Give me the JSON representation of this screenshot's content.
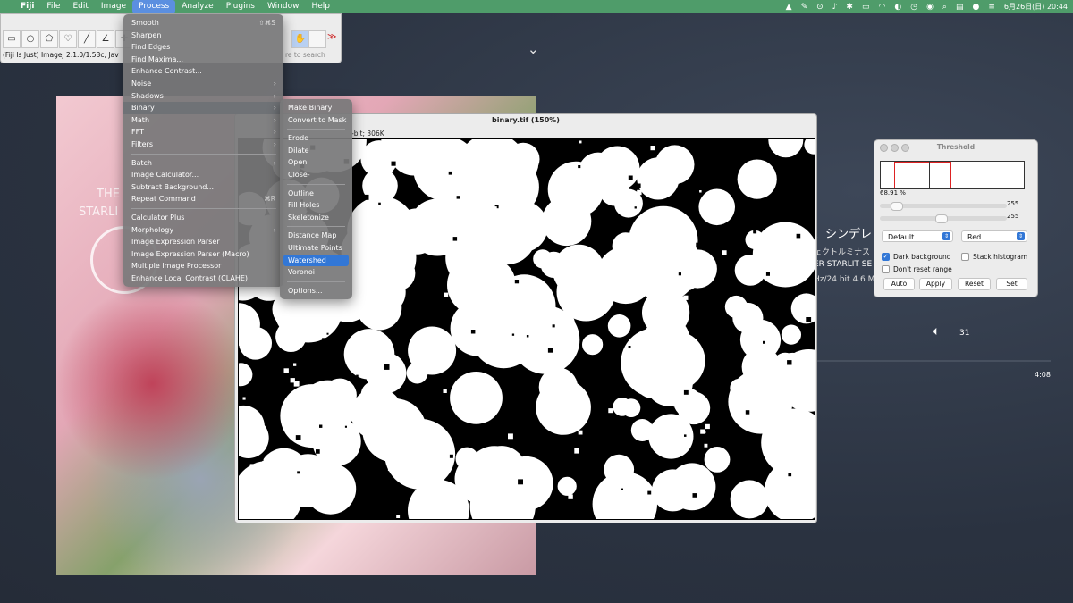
{
  "menubar": {
    "app_name": "Fiji",
    "menus": [
      "File",
      "Edit",
      "Image",
      "Process",
      "Analyze",
      "Plugins",
      "Window",
      "Help"
    ],
    "active_menu": "Process",
    "clock": "6月26日(日)  20:44"
  },
  "toolbar": {
    "status": "(Fiji Is Just) ImageJ 2.1.0/1.53c; Jav",
    "search_placeholder": "re to search"
  },
  "process_menu": {
    "items": [
      {
        "label": "Smooth",
        "shortcut": "⇧⌘S"
      },
      {
        "label": "Sharpen"
      },
      {
        "label": "Find Edges"
      },
      {
        "label": "Find Maxima..."
      },
      {
        "label": "Enhance Contrast..."
      },
      {
        "label": "Noise",
        "submenu": true
      },
      {
        "label": "Shadows",
        "submenu": true
      },
      {
        "label": "Binary",
        "submenu": true,
        "highlighted": true
      },
      {
        "label": "Math",
        "submenu": true
      },
      {
        "label": "FFT",
        "submenu": true
      },
      {
        "label": "Filters",
        "submenu": true
      },
      {
        "separator": true
      },
      {
        "label": "Batch",
        "submenu": true
      },
      {
        "label": "Image Calculator..."
      },
      {
        "label": "Subtract Background..."
      },
      {
        "label": "Repeat Command",
        "shortcut": "⌘R"
      },
      {
        "separator": true
      },
      {
        "label": "Calculator Plus"
      },
      {
        "label": "Morphology",
        "submenu": true
      },
      {
        "label": "Image Expression Parser"
      },
      {
        "label": "Image Expression Parser (Macro)"
      },
      {
        "label": "Multiple Image Processor"
      },
      {
        "label": "Enhance Local Contrast (CLAHE)"
      }
    ]
  },
  "binary_menu": {
    "items": [
      {
        "label": "Make Binary"
      },
      {
        "label": "Convert to Mask"
      },
      {
        "separator": true
      },
      {
        "label": "Erode"
      },
      {
        "label": "Dilate"
      },
      {
        "label": "Open"
      },
      {
        "label": "Close-"
      },
      {
        "separator": true
      },
      {
        "label": "Outline"
      },
      {
        "label": "Fill Holes"
      },
      {
        "label": "Skeletonize"
      },
      {
        "separator": true
      },
      {
        "label": "Distance Map"
      },
      {
        "label": "Ultimate Points"
      },
      {
        "label": "Watershed",
        "selected": true
      },
      {
        "label": "Voronoi"
      },
      {
        "separator": true
      },
      {
        "label": "Options..."
      }
    ]
  },
  "image_window": {
    "title": "binary.tif (150%)",
    "info": "-bit; 306K"
  },
  "threshold": {
    "title": "Threshold",
    "percent": "68.91 %",
    "slider1_value": "255",
    "slider2_value": "255",
    "method": "Default",
    "mode": "Red",
    "dark_background_label": "Dark background",
    "dark_background": true,
    "stack_histogram_label": "Stack histogram",
    "stack_histogram": false,
    "dont_reset_label": "Don't reset range",
    "dont_reset": false,
    "buttons": [
      "Auto",
      "Apply",
      "Reset",
      "Set"
    ]
  },
  "now_playing": {
    "title": "！シンデレ",
    "line1": "ェクトルミナス",
    "line2": "ER STARLIT SE",
    "line3": "Hz/24 bit 4.6 M",
    "volume": "31",
    "time": "4:08"
  },
  "album": {
    "text1": "THE",
    "text2": "STARLI"
  }
}
